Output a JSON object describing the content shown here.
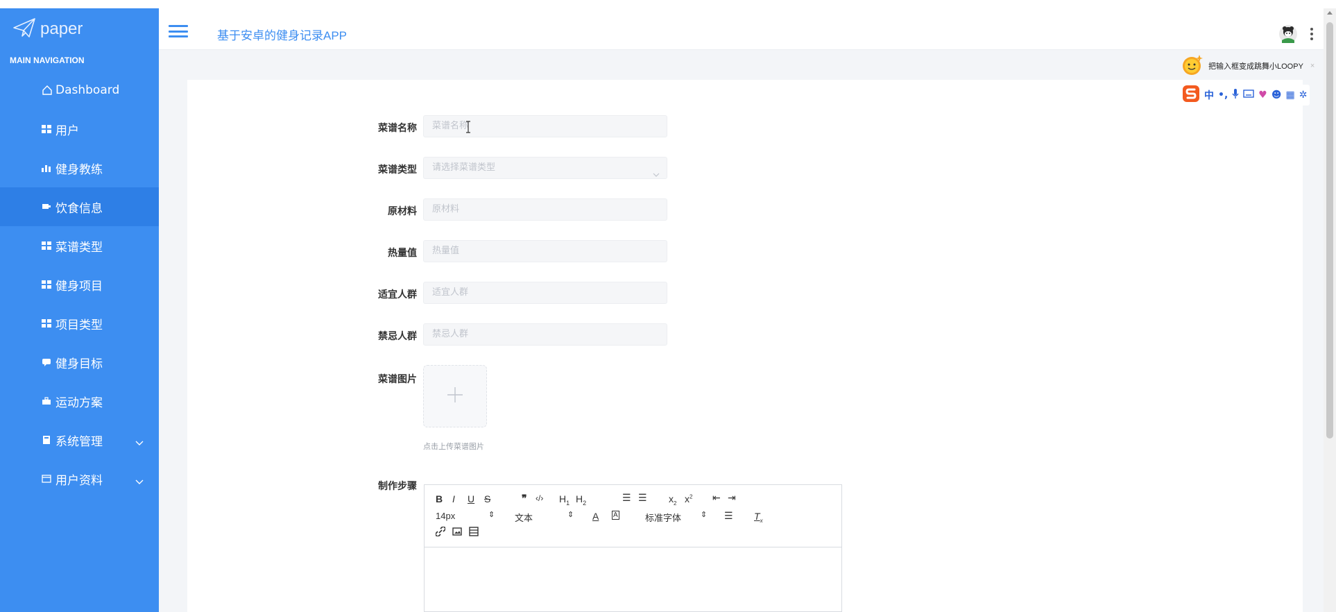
{
  "brand": {
    "name": "paper"
  },
  "sidebar": {
    "heading": "MAIN NAVIGATION",
    "items": [
      {
        "label": "Dashboard",
        "icon": "home-icon"
      },
      {
        "label": "用户",
        "icon": "grid-icon"
      },
      {
        "label": "健身教练",
        "icon": "bar-chart-icon"
      },
      {
        "label": "饮食信息",
        "icon": "cup-icon",
        "active": true
      },
      {
        "label": "菜谱类型",
        "icon": "grid-icon"
      },
      {
        "label": "健身项目",
        "icon": "grid-icon"
      },
      {
        "label": "项目类型",
        "icon": "grid-icon"
      },
      {
        "label": "健身目标",
        "icon": "message-icon"
      },
      {
        "label": "运动方案",
        "icon": "briefcase-icon"
      },
      {
        "label": "系统管理",
        "icon": "book-icon",
        "expandable": true
      },
      {
        "label": "用户资料",
        "icon": "calendar-icon",
        "expandable": true
      }
    ]
  },
  "header": {
    "title": "基于安卓的健身记录APP"
  },
  "form": {
    "name": {
      "label": "菜谱名称",
      "placeholder": "菜谱名称"
    },
    "type": {
      "label": "菜谱类型",
      "placeholder": "请选择菜谱类型"
    },
    "ingredients": {
      "label": "原材料",
      "placeholder": "原材料"
    },
    "calories": {
      "label": "热量值",
      "placeholder": "热量值"
    },
    "suitable": {
      "label": "适宜人群",
      "placeholder": "适宜人群"
    },
    "forbidden": {
      "label": "禁忌人群",
      "placeholder": "禁忌人群"
    },
    "image": {
      "label": "菜谱图片",
      "tip": "点击上传菜谱图片"
    },
    "steps": {
      "label": "制作步骤"
    }
  },
  "editor": {
    "font_size": "14px",
    "text_style": "文本",
    "font_family": "标准字体"
  },
  "ime": {
    "tip": "把输入框变成跳舞小LOOPY",
    "lang": "中"
  },
  "colors": {
    "primary": "#3d8ef1",
    "active": "#2e7fe6"
  }
}
